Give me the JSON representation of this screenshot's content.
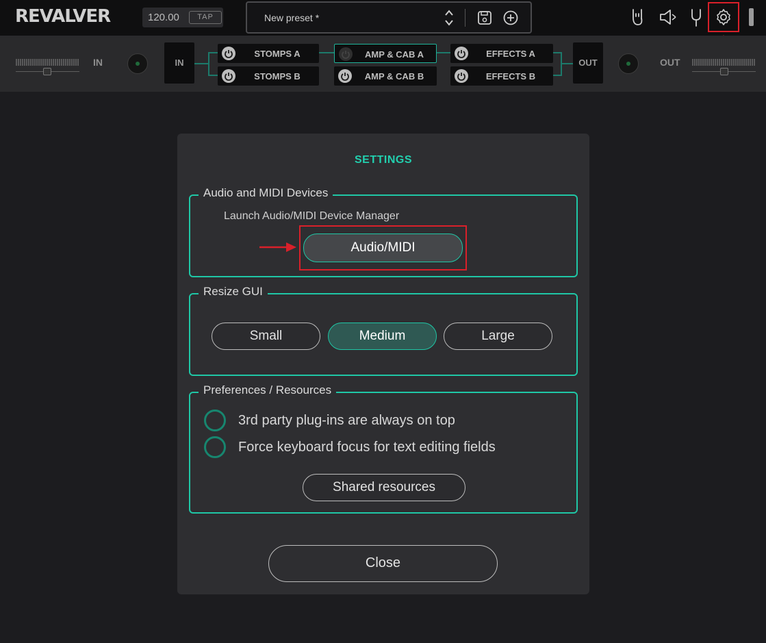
{
  "app": {
    "logo": "REVALVER"
  },
  "topbar": {
    "bpm": "120.00",
    "tap_label": "TAP",
    "preset_name": "New preset *",
    "icons": [
      "rock-hand-icon",
      "speaker-icon",
      "tuner-fork-icon",
      "gear-icon"
    ]
  },
  "routing": {
    "in_label": "IN",
    "out_label": "OUT",
    "in_block": "IN",
    "out_block": "OUT",
    "modules": {
      "stomps_a": "STOMPS A",
      "stomps_b": "STOMPS B",
      "amp_cab_a": "AMP & CAB A",
      "amp_cab_b": "AMP & CAB B",
      "effects_a": "EFFECTS A",
      "effects_b": "EFFECTS B"
    }
  },
  "settings": {
    "title": "SETTINGS",
    "audio_midi": {
      "legend": "Audio and MIDI Devices",
      "description": "Launch Audio/MIDI Device Manager",
      "button": "Audio/MIDI"
    },
    "resize": {
      "legend": "Resize GUI",
      "options": [
        "Small",
        "Medium",
        "Large"
      ],
      "selected": "Medium"
    },
    "preferences": {
      "legend": "Preferences / Resources",
      "options": [
        {
          "label": "3rd party plug-ins are always on top",
          "checked": false
        },
        {
          "label": "Force keyboard focus for text editing fields",
          "checked": false
        }
      ],
      "shared_button": "Shared resources"
    },
    "close_button": "Close"
  },
  "colors": {
    "accent": "#1fc7a6",
    "highlight": "#d9202a",
    "background": "#1c1c1f",
    "dialog": "#2e2e31"
  }
}
